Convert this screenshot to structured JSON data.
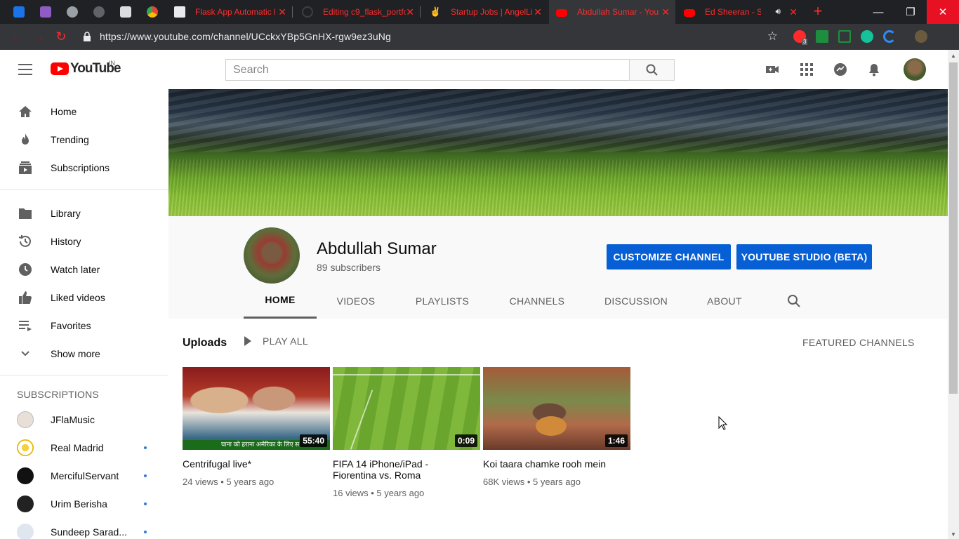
{
  "browser": {
    "tabs": [
      {
        "title": "Flask App Automatic l"
      },
      {
        "title": "Editing c9_flask_portfo"
      },
      {
        "title": "Startup Jobs | AngelLi"
      },
      {
        "title": "Abdullah Sumar - You"
      },
      {
        "title": "Ed Sheeran - Sha"
      }
    ],
    "new_tab": "+",
    "url": "https://www.youtube.com/channel/UCckxYBp5GnHX-rgw9ez3uNg",
    "extension_badge": "3",
    "accent_color": "#ff2b2b"
  },
  "masthead": {
    "logo_text": "YouTube",
    "country_code": "IN",
    "search_placeholder": "Search"
  },
  "sidebar": {
    "primary": [
      {
        "label": "Home",
        "icon": "home-icon"
      },
      {
        "label": "Trending",
        "icon": "flame-icon"
      },
      {
        "label": "Subscriptions",
        "icon": "subscriptions-icon"
      }
    ],
    "library": [
      {
        "label": "Library",
        "icon": "folder-icon"
      },
      {
        "label": "History",
        "icon": "history-icon"
      },
      {
        "label": "Watch later",
        "icon": "clock-icon"
      },
      {
        "label": "Liked videos",
        "icon": "thumbs-up-icon"
      },
      {
        "label": "Favorites",
        "icon": "playlist-icon"
      },
      {
        "label": "Show more",
        "icon": "chevron-down-icon"
      }
    ],
    "subscriptions_heading": "SUBSCRIPTIONS",
    "subscriptions": [
      {
        "label": "JFlaMusic",
        "new": false
      },
      {
        "label": "Real Madrid",
        "new": true
      },
      {
        "label": "MercifulServant",
        "new": true
      },
      {
        "label": "Urim Berisha",
        "new": true
      },
      {
        "label": "Sundeep Sarad...",
        "new": true
      }
    ]
  },
  "channel": {
    "name": "Abdullah Sumar",
    "subscribers": "89 subscribers",
    "customize_button": "CUSTOMIZE CHANNEL",
    "studio_button": "YOUTUBE STUDIO (BETA)",
    "tabs": [
      "HOME",
      "VIDEOS",
      "PLAYLISTS",
      "CHANNELS",
      "DISCUSSION",
      "ABOUT"
    ],
    "active_tab": "HOME"
  },
  "uploads": {
    "title": "Uploads",
    "play_all": "PLAY ALL",
    "featured_channels": "FEATURED CHANNELS",
    "videos": [
      {
        "title": "Centrifugal live*",
        "duration": "55:40",
        "views": "24 views",
        "age": "5 years ago",
        "caption": "घाना को हराना अमेरिका के लिए स"
      },
      {
        "title": "FIFA 14 iPhone/iPad - Fiorentina vs. Roma",
        "duration": "0:09",
        "views": "16 views",
        "age": "5 years ago"
      },
      {
        "title": "Koi taara chamke rooh mein",
        "duration": "1:46",
        "views": "68K views",
        "age": "5 years ago"
      }
    ]
  }
}
